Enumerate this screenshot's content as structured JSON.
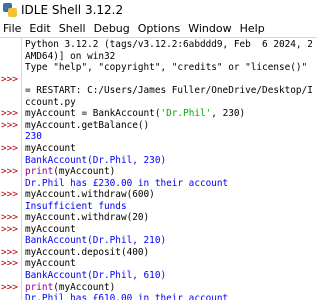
{
  "window": {
    "title": "IDLE Shell 3.12.2",
    "icon": "idle-python-icon"
  },
  "menubar": {
    "items": [
      "File",
      "Edit",
      "Shell",
      "Debug",
      "Options",
      "Window",
      "Help"
    ]
  },
  "shell": {
    "prompt": ">>>",
    "colors": {
      "prompt": "#c00000",
      "stdout": "#0000ff",
      "error": "#d00000",
      "string": "#00aa00",
      "builtin": "#900090"
    },
    "lines": [
      {
        "prompt": "",
        "style": "normal",
        "text": "Python 3.12.2 (tags/v3.12.2:6abddd9, Feb  6 2024, 2"
      },
      {
        "prompt": "",
        "style": "normal",
        "text": "AMD64)] on win32"
      },
      {
        "prompt": "",
        "style": "normal",
        "text": "Type \"help\", \"copyright\", \"credits\" or \"license()\""
      },
      {
        "prompt": ">>>",
        "style": "normal",
        "text": ""
      },
      {
        "prompt": "",
        "style": "normal",
        "text": "= RESTART: C:/Users/James Fuller/OneDrive/Desktop/I"
      },
      {
        "prompt": "",
        "style": "normal",
        "text": "ccount.py"
      },
      {
        "prompt": ">>>",
        "style": "code",
        "pre": "myAccount = BankAccount(",
        "str": "'Dr.Phil'",
        "post": ", 230)"
      },
      {
        "prompt": ">>>",
        "style": "normal",
        "text": "myAccount.getBalance()"
      },
      {
        "prompt": "",
        "style": "out",
        "text": "230"
      },
      {
        "prompt": ">>>",
        "style": "normal",
        "text": "myAccount"
      },
      {
        "prompt": "",
        "style": "out",
        "text": "BankAccount(Dr.Phil, 230)"
      },
      {
        "prompt": ">>>",
        "style": "builtin",
        "kw": "print",
        "post": "(myAccount)"
      },
      {
        "prompt": "",
        "style": "out",
        "text": "Dr.Phil has £230.00 in their account"
      },
      {
        "prompt": ">>>",
        "style": "normal",
        "text": "myAccount.withdraw(600)"
      },
      {
        "prompt": "",
        "style": "out",
        "text": "Insufficient funds"
      },
      {
        "prompt": ">>>",
        "style": "normal",
        "text": "myAccount.withdraw(20)"
      },
      {
        "prompt": ">>>",
        "style": "normal",
        "text": "myAccount"
      },
      {
        "prompt": "",
        "style": "out",
        "text": "BankAccount(Dr.Phil, 210)"
      },
      {
        "prompt": ">>>",
        "style": "normal",
        "text": "myAccount.deposit(400)"
      },
      {
        "prompt": ">>>",
        "style": "normal",
        "text": "myAccount"
      },
      {
        "prompt": "",
        "style": "out",
        "text": "BankAccount(Dr.Phil, 610)"
      },
      {
        "prompt": ">>>",
        "style": "builtin",
        "kw": "print",
        "post": "(myAccount)"
      },
      {
        "prompt": "",
        "style": "out",
        "text": "Dr.Phil has £610.00 in their account"
      }
    ]
  }
}
